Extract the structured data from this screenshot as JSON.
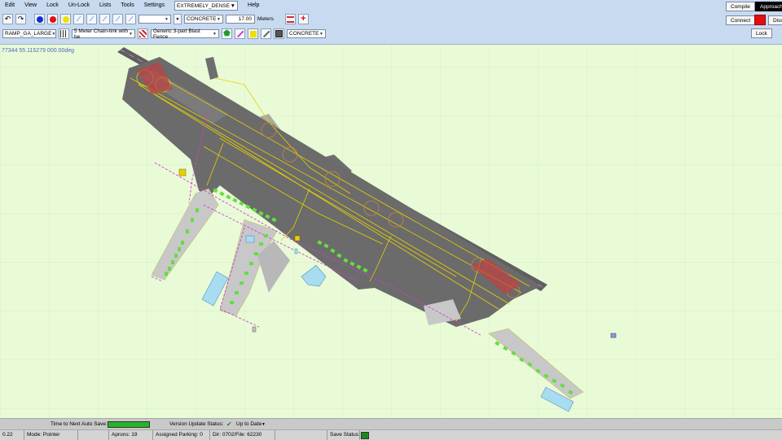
{
  "menu": {
    "items": [
      "Edit",
      "View",
      "Lock",
      "Un-Lock",
      "Lists",
      "Tools",
      "Settings"
    ],
    "density": "EXTREMELY_DENSE",
    "help": "Help"
  },
  "toolbar1": {
    "line_type": "",
    "surface": "CONCRETE",
    "width_value": "17.00",
    "width_unit": "Meters"
  },
  "toolbar2": {
    "ramp_type": "RAMP_GA_LARGE",
    "fence_type": "5 Meter Chain-link with be",
    "blast_fence": "Generic 3-part Blast Fence",
    "surface2": "CONCRETE"
  },
  "right_panel": {
    "compile": "Compile",
    "approach": "Approach",
    "connect": "Connect",
    "disconnect": "Disco",
    "lock": "Lock"
  },
  "map": {
    "coords": "77344   55.115279 000.00deg"
  },
  "status": {
    "autosave_label": "Time to Next Auto Save:",
    "version_label": "Version Update Status:",
    "version_value": "Up to Date",
    "coord_cell": "0.22",
    "mode": "Mode: Pointer",
    "aprons": "Aprons: 19",
    "assigned_parking": "Assigned Parking: 0",
    "dir_file": "Dir: 0702/File: 62230",
    "save_status": "Save Status:"
  },
  "colors": {
    "toolbar_bg": "#c8daf0",
    "map_bg": "#e9fbd6",
    "asphalt": "#6b6b6b",
    "taxi_line": "#e8d000",
    "fence": "#d040d0",
    "parking": "#66dd44",
    "apron_concrete": "#c8c8c8",
    "water": "#a8dcf0",
    "autosave_bar": "#28b428",
    "save_ok": "#1a8a1a"
  }
}
